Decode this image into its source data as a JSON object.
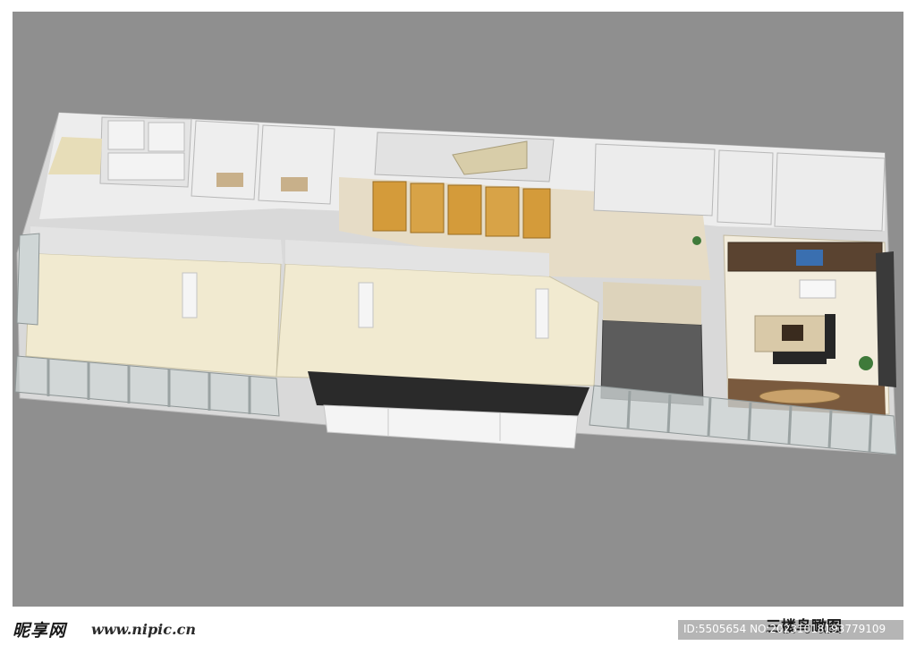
{
  "image": {
    "caption": "三楼鸟瞰图",
    "watermark": {
      "logo_text": "昵享网",
      "site_url": "www.nipic.cn",
      "id_text": "ID:5505654 NO:20231018193779109"
    }
  },
  "colors": {
    "background": "#8f8f8f",
    "wall": "#e8e8e8",
    "wall_shadow": "#bdbdbd",
    "floor": "#f1ead0",
    "corridor_floor": "#e6dcc6",
    "tile_floor": "#5c5c5c",
    "wood_floor": "#7a5a3e",
    "accent_panels": "#d49b3a",
    "glass": "#cfd6d6"
  }
}
